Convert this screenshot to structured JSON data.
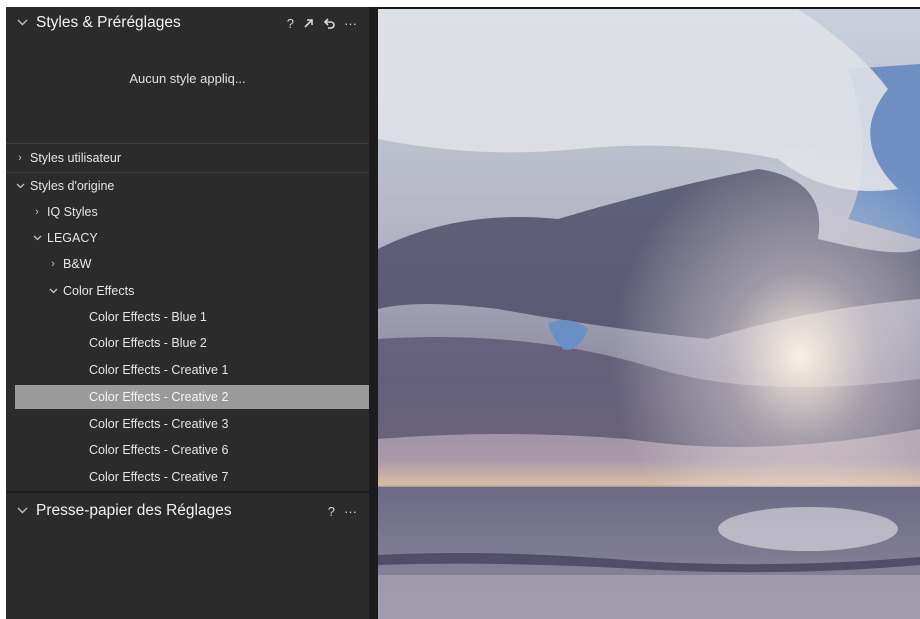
{
  "styles_panel": {
    "title": "Styles & Préréglages",
    "tools": {
      "help": "?",
      "more": "···"
    },
    "empty_message": "Aucun style appliq...",
    "tree": [
      {
        "label": "Styles utilisateur",
        "state": "collapsed",
        "level": 0
      },
      {
        "label": "Styles d'origine",
        "state": "expanded",
        "level": 0
      },
      {
        "label": "IQ Styles",
        "state": "collapsed",
        "level": 1
      },
      {
        "label": "LEGACY",
        "state": "expanded",
        "level": 1
      },
      {
        "label": "B&W",
        "state": "collapsed",
        "level": 2
      },
      {
        "label": "Color Effects",
        "state": "expanded",
        "level": 2
      },
      {
        "label": "Color Effects - Blue 1",
        "level": 3
      },
      {
        "label": "Color Effects - Blue 2",
        "level": 3
      },
      {
        "label": "Color Effects - Creative 1",
        "level": 3
      },
      {
        "label": "Color Effects - Creative 2",
        "level": 3,
        "selected": true
      },
      {
        "label": "Color Effects - Creative 3",
        "level": 3
      },
      {
        "label": "Color Effects - Creative 6",
        "level": 3
      },
      {
        "label": "Color Effects - Creative 7",
        "level": 3
      }
    ]
  },
  "clipboard_panel": {
    "title": "Presse-papier des Réglages",
    "tools": {
      "help": "?",
      "more": "···"
    }
  },
  "colors": {
    "panel_bg": "#2b2b2b",
    "selected_row": "#9a9a9a",
    "text": "#e6e6e6"
  },
  "icons": [
    "chevron-down-icon",
    "help-icon",
    "apply-style-icon",
    "undo-icon",
    "more-icon",
    "chevron-right-icon"
  ]
}
